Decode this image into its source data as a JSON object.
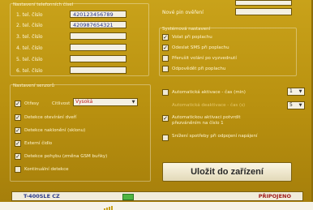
{
  "phone_numbers": {
    "group_title": "Nastavení telefonních čísel",
    "rows": [
      {
        "label": "1. tel. číslo",
        "value": "420123456789"
      },
      {
        "label": "2. tel. číslo",
        "value": "420987654321"
      },
      {
        "label": "3. tel. číslo",
        "value": ""
      },
      {
        "label": "4. tel. číslo",
        "value": ""
      },
      {
        "label": "5. tel. číslo",
        "value": ""
      },
      {
        "label": "6. tel. číslo",
        "value": ""
      }
    ]
  },
  "top_right": {
    "new_pin_label": "Nové pin ověření"
  },
  "sensors": {
    "group_title": "Nastavení senzorů",
    "shock_label": "Otřesy",
    "sensitivity_label": "Citlivost",
    "sensitivity_value": "Vysoká",
    "items": [
      {
        "label": "Detekce otevírání dveří",
        "checked": true
      },
      {
        "label": "Detekce naklonění (sklonu)",
        "checked": true
      },
      {
        "label": "Externí čidlo",
        "checked": true
      },
      {
        "label": "Detekce pohybu (změna GSM buňky)",
        "checked": true
      },
      {
        "label": "Kontinuální detekce",
        "checked": false
      }
    ]
  },
  "system": {
    "group_title": "Systémová nastavení",
    "items": [
      {
        "label": "Volat při poplachu",
        "checked": true
      },
      {
        "label": "Odeslat SMS při poplachu",
        "checked": true
      },
      {
        "label": "Přerušit volání po vyzvednutí",
        "checked": false
      },
      {
        "label": "Odpovědět při poplachu",
        "checked": false
      }
    ],
    "auto_activate_label": "Automatická aktivace - čas (min)",
    "auto_activate_value": "1",
    "auto_deactivate_label": "Automatická deaktivace - čas (s)",
    "auto_deactivate_value": "5",
    "auto_confirm_label": "Automatickou aktivaci potvrdit přezváněním na číslo 1",
    "auto_confirm_checked": true,
    "reduce_label": "Snížení spotřeby při odpojení napájení",
    "reduce_checked": false
  },
  "save_button": "Uložit do zařízení",
  "status_bar": {
    "device": "T-400SLE CZ",
    "connection": "PŘIPOJENO"
  }
}
